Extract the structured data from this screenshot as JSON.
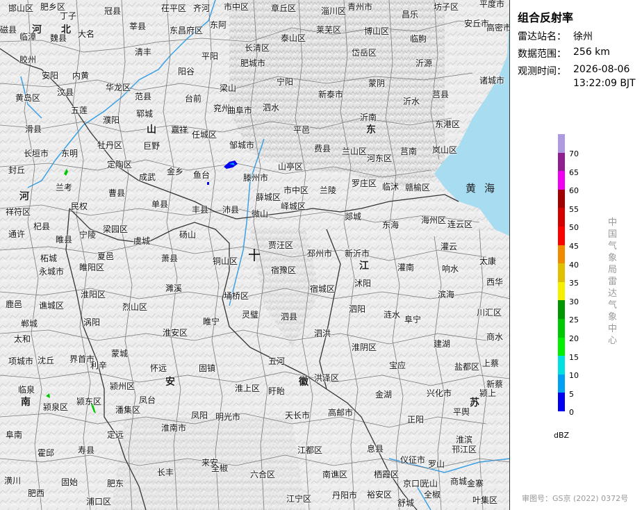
{
  "panel": {
    "title": "组合反射率",
    "station_label": "雷达站名：",
    "station_value": "徐州",
    "range_label": "数据范围：",
    "range_value": "256 km",
    "time_label": "观测时间：",
    "time_value_date": "2026-08-06",
    "time_value_clock": "13:22:09 BJT",
    "unit": "dBZ",
    "vertical_text": "中国气象局雷达气象中心",
    "approval": "审图号：GS京 (2022) 0372号"
  },
  "legend": [
    {
      "value": "70",
      "color": "#ae9ae0"
    },
    {
      "value": "65",
      "color": "#8f1e8f"
    },
    {
      "value": "60",
      "color": "#f000f0"
    },
    {
      "value": "55",
      "color": "#a00000"
    },
    {
      "value": "50",
      "color": "#d40000"
    },
    {
      "value": "45",
      "color": "#ff0000"
    },
    {
      "value": "40",
      "color": "#f08a00"
    },
    {
      "value": "35",
      "color": "#e0c000"
    },
    {
      "value": "30",
      "color": "#f5f000"
    },
    {
      "value": "25",
      "color": "#009600"
    },
    {
      "value": "20",
      "color": "#00c800"
    },
    {
      "value": "15",
      "color": "#00f000"
    },
    {
      "value": "10",
      "color": "#00e0e0"
    },
    {
      "value": "5",
      "color": "#00a0f5"
    },
    {
      "value": "0",
      "color": "#0000f0"
    }
  ],
  "map": {
    "sea_label": "黄海",
    "sea_color": "#a8dcf0",
    "river_color": "#3aa0e6",
    "provinces": [
      "河",
      "北",
      "山",
      "东",
      "河",
      "南",
      "安",
      "徽",
      "江",
      "苏"
    ],
    "places": [
      "邯山区",
      "肥乡区",
      "丁子",
      "冠县",
      "茌平区",
      "齐河",
      "市中区",
      "章丘区",
      "淄川区",
      "青州市",
      "昌乐",
      "坊子区",
      "平度市",
      "磁县",
      "临漳",
      "魏县",
      "大名",
      "莘县",
      "东昌府区",
      "东阿",
      "长清区",
      "泰山区",
      "莱芜区",
      "博山区",
      "临朐",
      "安丘市",
      "高密市",
      "胶州",
      "安阳",
      "内黄",
      "清丰",
      "阳谷",
      "平阳",
      "肥城市",
      "岱岳区",
      "沂源",
      "诸城市",
      "黄岛区",
      "汶县",
      "华龙区",
      "范县",
      "台前",
      "梁山",
      "宁阳",
      "新泰市",
      "蒙阴",
      "沂水",
      "莒县",
      "五莲",
      "濮阳",
      "郓城",
      "汶上",
      "兖州",
      "曲阜市",
      "泗水",
      "平邑",
      "沂南",
      "东港区",
      "滑县",
      "长垣市",
      "东明",
      "牡丹区",
      "巨野",
      "嘉祥",
      "任城区",
      "邹城市",
      "费县",
      "兰山区",
      "莒南",
      "岚山区",
      "封丘",
      "定陶区",
      "金乡",
      "鱼台",
      "滕州市",
      "山亭区",
      "河东区",
      "罗庄区",
      "临沭",
      "赣榆区",
      "兰考",
      "民权",
      "曹县",
      "成武",
      "单县",
      "丰县",
      "沛县",
      "薛城区",
      "市中区",
      "峄城区",
      "兰陵",
      "郯城",
      "东海",
      "海州区",
      "连云区",
      "祥符区",
      "杞县",
      "睢县",
      "宁陵",
      "梁园区",
      "虞城",
      "砀山",
      "微山",
      "贾汪区",
      "邳州市",
      "新沂市",
      "灌云",
      "通许",
      "柘城",
      "睢阳区",
      "夏邑",
      "萧县",
      "铜山区",
      "宿豫区",
      "沭阳",
      "灌南",
      "响水",
      "太康",
      "永城市",
      "濉溪",
      "睢宁",
      "宿城区",
      "泗阳",
      "涟水",
      "滨海",
      "西华",
      "鹿邑",
      "淮阳区",
      "谯城区",
      "烈山区",
      "埇桥区",
      "灵璧",
      "泗县",
      "泗洪",
      "淮阴区",
      "阜宁",
      "川汇区",
      "郸城",
      "涡阳",
      "淮安区",
      "建湖",
      "商水",
      "太和",
      "蒙城",
      "固镇",
      "五河",
      "洪泽区",
      "宝应",
      "盐都区",
      "上蔡",
      "项城市",
      "沈丘",
      "界首市",
      "利辛",
      "怀远",
      "淮上区",
      "盱眙",
      "金湖",
      "兴化市",
      "平舆",
      "新蔡",
      "临泉",
      "颍泉区",
      "颍东区",
      "颍州区",
      "凤台",
      "潘集区",
      "凤阳",
      "明光市",
      "天长市",
      "高邮市",
      "正阳",
      "颍上",
      "阜南",
      "淮南市",
      "定远",
      "来安",
      "江都区",
      "息县",
      "淮滨",
      "霍邱",
      "寿县",
      "长丰",
      "全椒",
      "六合区",
      "仪征市",
      "邗江区",
      "罗山",
      "潢川",
      "固始",
      "肥东",
      "南谯区",
      "栖霞区",
      "京口区",
      "光山",
      "商城",
      "金寨",
      "肥西",
      "浦口区",
      "江宁区",
      "丹阳市",
      "裕安区",
      "舒城",
      "全椒",
      "叶集区"
    ]
  }
}
